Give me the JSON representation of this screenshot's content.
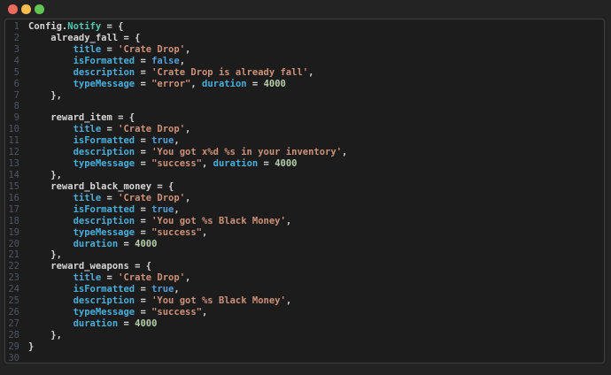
{
  "window": {
    "background_color": "#232323",
    "controls": [
      {
        "name": "close",
        "color": "#ed6a5e"
      },
      {
        "name": "minimize",
        "color": "#f4bf4f"
      },
      {
        "name": "maximize",
        "color": "#61c554"
      }
    ]
  },
  "editor": {
    "language": "lua",
    "panel_background": "#1c1c1c",
    "panel_border_color": "#3e3e3e",
    "line_number_color": "#4e5563",
    "token_colors": {
      "plain": "#d6d6d6",
      "type": "#4ec9b0",
      "prop": "#4aaeda",
      "bool": "#569cd6",
      "string": "#ce9178",
      "number": "#b5cea8"
    },
    "lines": [
      {
        "n": 1,
        "tokens": [
          [
            "Config.",
            "plain"
          ],
          [
            "Notify",
            "type"
          ],
          [
            " = {",
            "plain"
          ]
        ]
      },
      {
        "n": 2,
        "tokens": [
          [
            "    already_fall = {",
            "plain"
          ]
        ]
      },
      {
        "n": 3,
        "tokens": [
          [
            "        ",
            "plain"
          ],
          [
            "title",
            "prop"
          ],
          [
            " = ",
            "plain"
          ],
          [
            "'Crate Drop'",
            "string"
          ],
          [
            ",",
            "plain"
          ]
        ]
      },
      {
        "n": 4,
        "tokens": [
          [
            "        ",
            "plain"
          ],
          [
            "isFormatted",
            "prop"
          ],
          [
            " = ",
            "plain"
          ],
          [
            "false",
            "bool"
          ],
          [
            ",",
            "plain"
          ]
        ]
      },
      {
        "n": 5,
        "tokens": [
          [
            "        ",
            "plain"
          ],
          [
            "description",
            "prop"
          ],
          [
            " = ",
            "plain"
          ],
          [
            "'Crate Drop is already fall'",
            "string"
          ],
          [
            ",",
            "plain"
          ]
        ]
      },
      {
        "n": 6,
        "tokens": [
          [
            "        ",
            "plain"
          ],
          [
            "typeMessage",
            "prop"
          ],
          [
            " = ",
            "plain"
          ],
          [
            "\"error\"",
            "string"
          ],
          [
            ", ",
            "plain"
          ],
          [
            "duration",
            "prop"
          ],
          [
            " = ",
            "plain"
          ],
          [
            "4000",
            "number"
          ]
        ]
      },
      {
        "n": 7,
        "tokens": [
          [
            "    },",
            "plain"
          ]
        ]
      },
      {
        "n": 8,
        "tokens": []
      },
      {
        "n": 9,
        "tokens": [
          [
            "    reward_item = {",
            "plain"
          ]
        ]
      },
      {
        "n": 10,
        "tokens": [
          [
            "        ",
            "plain"
          ],
          [
            "title",
            "prop"
          ],
          [
            " = ",
            "plain"
          ],
          [
            "'Crate Drop'",
            "string"
          ],
          [
            ",",
            "plain"
          ]
        ]
      },
      {
        "n": 11,
        "tokens": [
          [
            "        ",
            "plain"
          ],
          [
            "isFormatted",
            "prop"
          ],
          [
            " = ",
            "plain"
          ],
          [
            "true",
            "bool"
          ],
          [
            ",",
            "plain"
          ]
        ]
      },
      {
        "n": 12,
        "tokens": [
          [
            "        ",
            "plain"
          ],
          [
            "description",
            "prop"
          ],
          [
            " = ",
            "plain"
          ],
          [
            "'You got x%d %s in your inventory'",
            "string"
          ],
          [
            ",",
            "plain"
          ]
        ]
      },
      {
        "n": 13,
        "tokens": [
          [
            "        ",
            "plain"
          ],
          [
            "typeMessage",
            "prop"
          ],
          [
            " = ",
            "plain"
          ],
          [
            "\"success\"",
            "string"
          ],
          [
            ", ",
            "plain"
          ],
          [
            "duration",
            "prop"
          ],
          [
            " = ",
            "plain"
          ],
          [
            "4000",
            "number"
          ]
        ]
      },
      {
        "n": 14,
        "tokens": [
          [
            "    },",
            "plain"
          ]
        ]
      },
      {
        "n": 15,
        "tokens": [
          [
            "    reward_black_money = {",
            "plain"
          ]
        ]
      },
      {
        "n": 16,
        "tokens": [
          [
            "        ",
            "plain"
          ],
          [
            "title",
            "prop"
          ],
          [
            " = ",
            "plain"
          ],
          [
            "'Crate Drop'",
            "string"
          ],
          [
            ",",
            "plain"
          ]
        ]
      },
      {
        "n": 17,
        "tokens": [
          [
            "        ",
            "plain"
          ],
          [
            "isFormatted",
            "prop"
          ],
          [
            " = ",
            "plain"
          ],
          [
            "true",
            "bool"
          ],
          [
            ",",
            "plain"
          ]
        ]
      },
      {
        "n": 18,
        "tokens": [
          [
            "        ",
            "plain"
          ],
          [
            "description",
            "prop"
          ],
          [
            " = ",
            "plain"
          ],
          [
            "'You got %s Black Money'",
            "string"
          ],
          [
            ",",
            "plain"
          ]
        ]
      },
      {
        "n": 19,
        "tokens": [
          [
            "        ",
            "plain"
          ],
          [
            "typeMessage",
            "prop"
          ],
          [
            " = ",
            "plain"
          ],
          [
            "\"success\"",
            "string"
          ],
          [
            ",",
            "plain"
          ]
        ]
      },
      {
        "n": 20,
        "tokens": [
          [
            "        ",
            "plain"
          ],
          [
            "duration",
            "prop"
          ],
          [
            " = ",
            "plain"
          ],
          [
            "4000",
            "number"
          ]
        ]
      },
      {
        "n": 21,
        "tokens": [
          [
            "    },",
            "plain"
          ]
        ]
      },
      {
        "n": 22,
        "tokens": [
          [
            "    reward_weapons = {",
            "plain"
          ]
        ]
      },
      {
        "n": 23,
        "tokens": [
          [
            "        ",
            "plain"
          ],
          [
            "title",
            "prop"
          ],
          [
            " = ",
            "plain"
          ],
          [
            "'Crate Drop'",
            "string"
          ],
          [
            ",",
            "plain"
          ]
        ]
      },
      {
        "n": 24,
        "tokens": [
          [
            "        ",
            "plain"
          ],
          [
            "isFormatted",
            "prop"
          ],
          [
            " = ",
            "plain"
          ],
          [
            "true",
            "bool"
          ],
          [
            ",",
            "plain"
          ]
        ]
      },
      {
        "n": 25,
        "tokens": [
          [
            "        ",
            "plain"
          ],
          [
            "description",
            "prop"
          ],
          [
            " = ",
            "plain"
          ],
          [
            "'You got %s Black Money'",
            "string"
          ],
          [
            ",",
            "plain"
          ]
        ]
      },
      {
        "n": 26,
        "tokens": [
          [
            "        ",
            "plain"
          ],
          [
            "typeMessage",
            "prop"
          ],
          [
            " = ",
            "plain"
          ],
          [
            "\"success\"",
            "string"
          ],
          [
            ",",
            "plain"
          ]
        ]
      },
      {
        "n": 27,
        "tokens": [
          [
            "        ",
            "plain"
          ],
          [
            "duration",
            "prop"
          ],
          [
            " = ",
            "plain"
          ],
          [
            "4000",
            "number"
          ]
        ]
      },
      {
        "n": 28,
        "tokens": [
          [
            "    },",
            "plain"
          ]
        ]
      },
      {
        "n": 29,
        "tokens": [
          [
            "}",
            "plain"
          ]
        ]
      },
      {
        "n": 30,
        "tokens": []
      }
    ]
  }
}
